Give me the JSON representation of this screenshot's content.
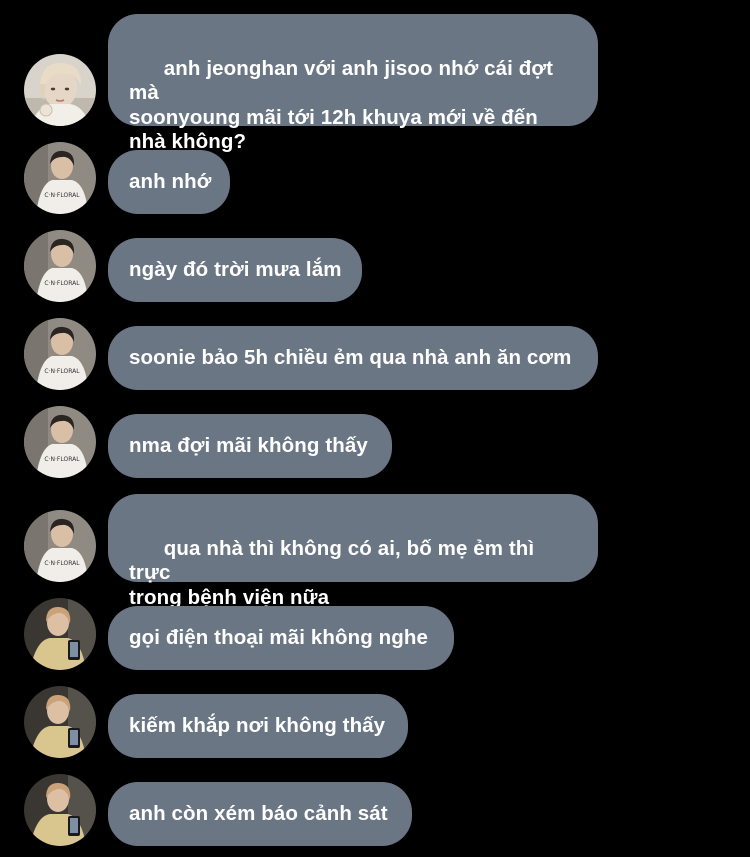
{
  "thread": {
    "messages": [
      {
        "text": "anh jeonghan với anh jisoo nhớ cái đợt mà\nsoonyoung mãi tới 12h khuya mới về đến\nnhà không?",
        "avatar": "avatar-blond-portrait"
      },
      {
        "text": "anh nhớ",
        "avatar": "avatar-white-tee"
      },
      {
        "text": "ngày đó trời mưa lắm",
        "avatar": "avatar-white-tee"
      },
      {
        "text": "soonie bảo 5h chiều ẻm qua nhà anh ăn cơm",
        "avatar": "avatar-white-tee"
      },
      {
        "text": "nma đợi mãi không thấy",
        "avatar": "avatar-white-tee"
      },
      {
        "text": "qua nhà thì không có ai, bố mẹ ẻm thì trực\ntrong bệnh viện nữa",
        "avatar": "avatar-white-tee"
      },
      {
        "text": "gọi điện thoại mãi không nghe",
        "avatar": "avatar-phone-selfie"
      },
      {
        "text": "kiếm khắp nơi không thấy",
        "avatar": "avatar-phone-selfie"
      },
      {
        "text": "anh còn xém báo cảnh sát",
        "avatar": "avatar-phone-selfie"
      }
    ]
  },
  "colors": {
    "background": "#000000",
    "bubble": "#6b7685",
    "text": "#ffffff"
  }
}
